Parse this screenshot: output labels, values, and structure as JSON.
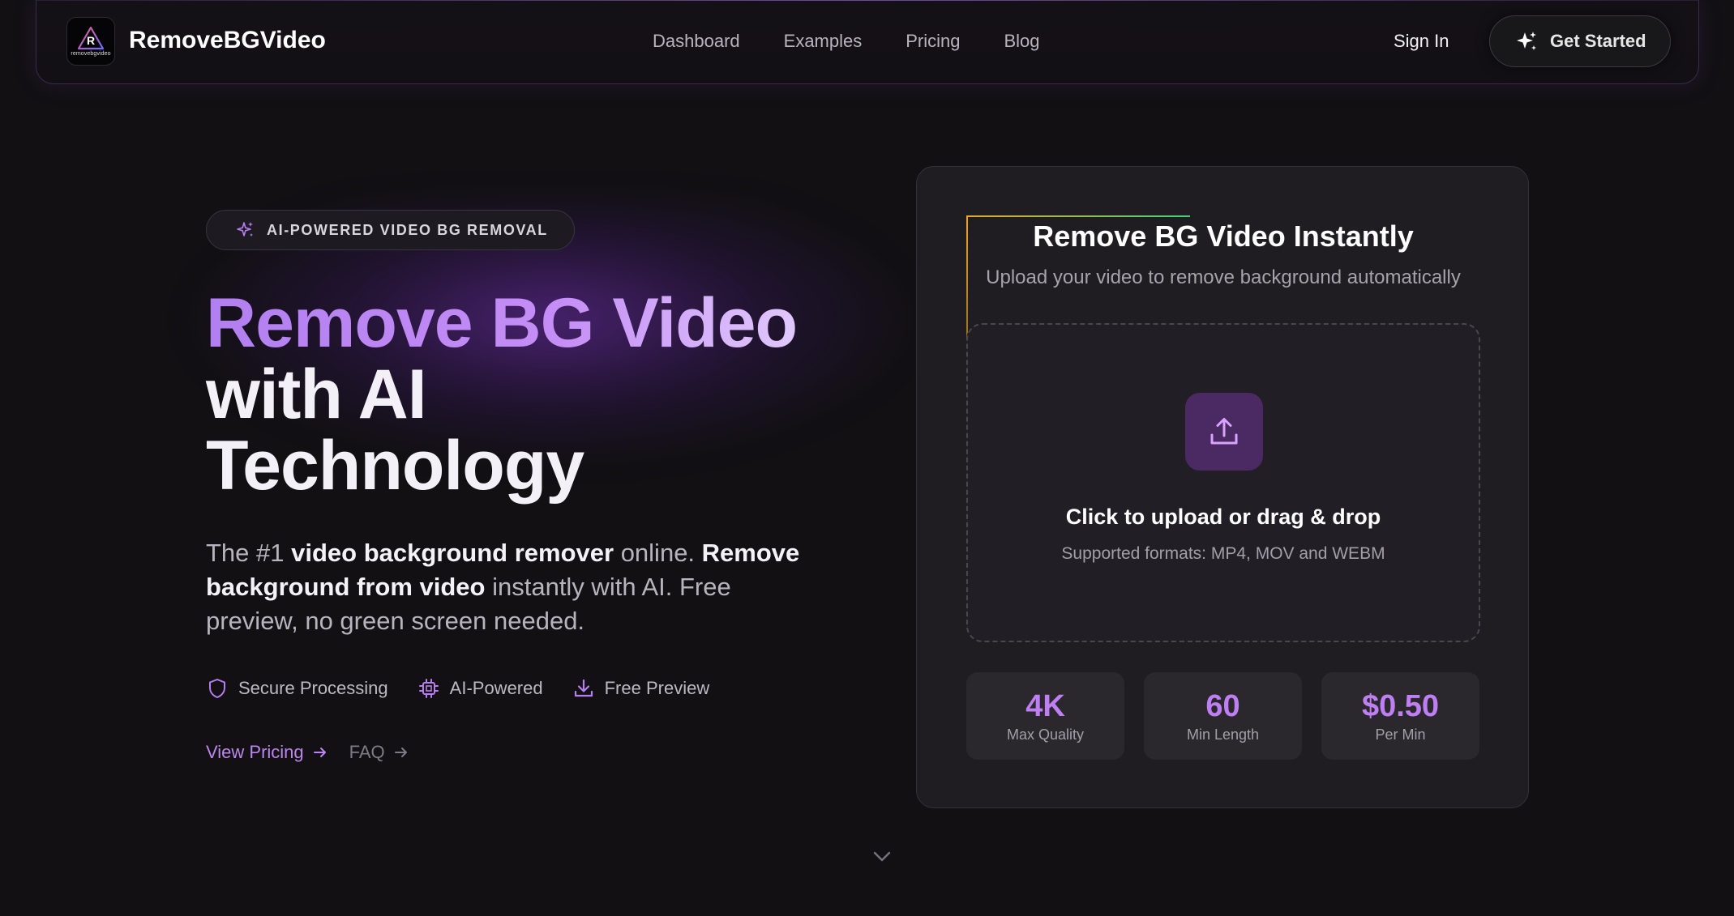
{
  "nav": {
    "logo_text": "removebgvideo",
    "brand": "RemoveBGVideo",
    "links": [
      "Dashboard",
      "Examples",
      "Pricing",
      "Blog"
    ],
    "sign_in": "Sign In",
    "get_started": "Get Started"
  },
  "hero": {
    "badge": "AI-POWERED VIDEO BG REMOVAL",
    "title_line1": "Remove BG Video",
    "title_line2": "with AI",
    "title_line3": "Technology",
    "lead": {
      "p1": "The #1 ",
      "b1": "video background remover",
      "p2": " online. ",
      "b2": "Remove background from video",
      "p3": " instantly with AI. Free preview, no green screen needed."
    },
    "features": [
      {
        "label": "Secure Processing",
        "icon": "shield-icon"
      },
      {
        "label": "AI-Powered",
        "icon": "chip-icon"
      },
      {
        "label": "Free Preview",
        "icon": "download-icon"
      }
    ],
    "links": {
      "pricing": "View Pricing",
      "faq": "FAQ"
    }
  },
  "card": {
    "title": "Remove BG Video Instantly",
    "subtitle": "Upload your video to remove background automatically",
    "dropzone_title": "Click to upload or drag & drop",
    "dropzone_sub": "Supported formats: MP4, MOV and WEBM",
    "stats": [
      {
        "value": "4K",
        "label": "Max Quality"
      },
      {
        "value": "60",
        "label": "Min Length"
      },
      {
        "value": "$0.50",
        "label": "Per Min"
      }
    ]
  },
  "colors": {
    "accent": "#bf7ff2",
    "background": "#121013",
    "card": "#1f1d22"
  }
}
